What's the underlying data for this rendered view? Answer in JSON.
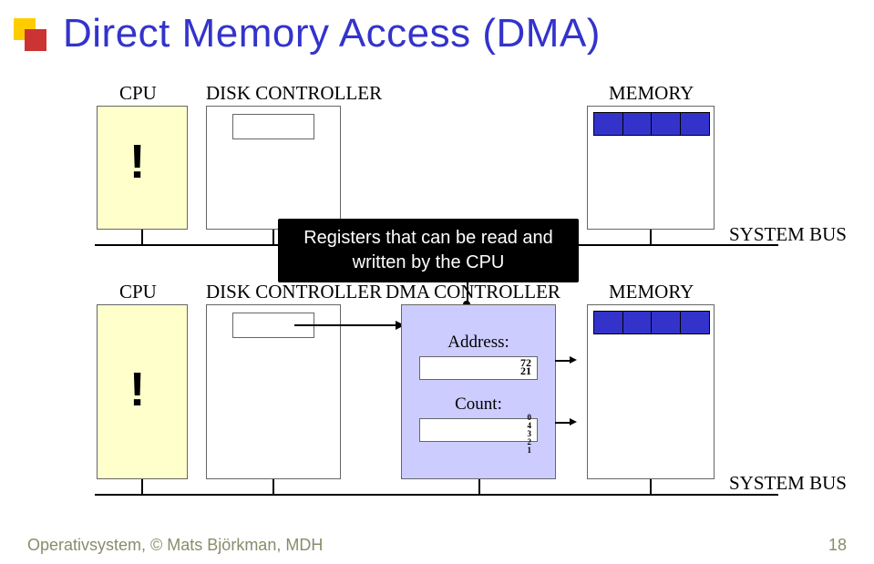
{
  "title": "Direct Memory Access (DMA)",
  "top": {
    "cpu": "CPU",
    "disk": "DISK CONTROLLER",
    "memory": "MEMORY",
    "bus": "SYSTEM BUS",
    "exclaim": "!"
  },
  "bottom": {
    "cpu": "CPU",
    "disk": "DISK CONTROLLER",
    "dma": "DMA CONTROLLER",
    "memory": "MEMORY",
    "bus": "SYSTEM BUS",
    "exclaim": "!",
    "address_label": "Address:",
    "count_label": "Count:",
    "address_nums": "72\n21",
    "count_nums": "0\n4\n3\n2\n1"
  },
  "callout": "Registers that can be read and\nwritten by the CPU",
  "footer": {
    "left": "Operativsystem, © Mats Björkman, MDH",
    "right": "18"
  }
}
